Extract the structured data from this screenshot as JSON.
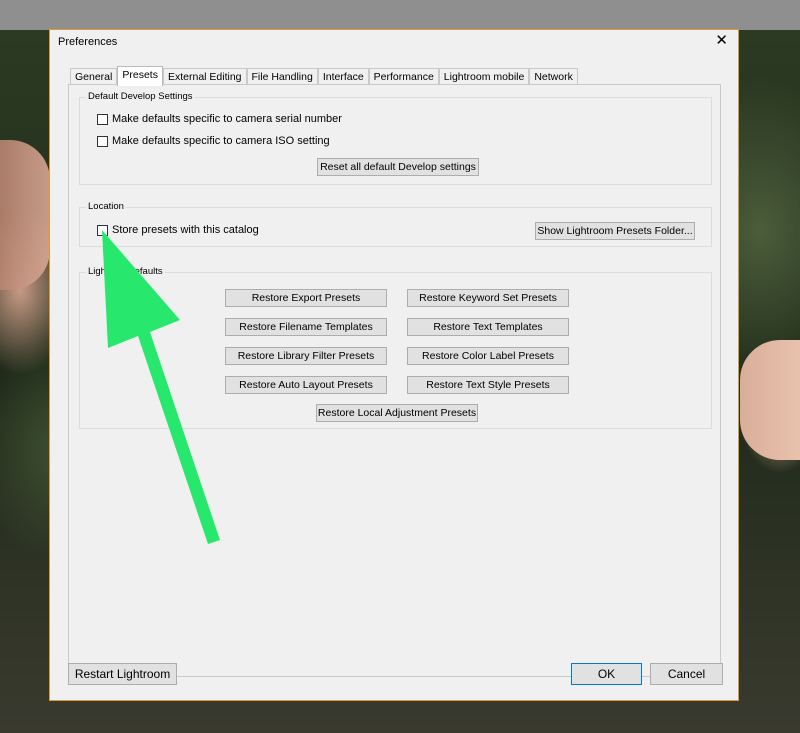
{
  "dialog": {
    "title": "Preferences",
    "close_glyph": "✕",
    "tabs": [
      "General",
      "Presets",
      "External Editing",
      "File Handling",
      "Interface",
      "Performance",
      "Lightroom mobile",
      "Network"
    ],
    "active_tab": "Presets"
  },
  "default_develop": {
    "title": "Default Develop Settings",
    "serial_label": "Make defaults specific to camera serial number",
    "iso_label": "Make defaults specific to camera ISO setting",
    "reset_button": "Reset all default Develop settings"
  },
  "location": {
    "title": "Location",
    "store_label": "Store presets with this catalog",
    "show_folder_button": "Show Lightroom Presets Folder..."
  },
  "defaults": {
    "title_visible": "Lightr",
    "title_suffix": "Defaults",
    "buttons": [
      "Restore Export Presets",
      "Restore Keyword Set Presets",
      "Restore Filename Templates",
      "Restore Text Templates",
      "Restore Library Filter Presets",
      "Restore Color Label Presets",
      "Restore Auto Layout Presets",
      "Restore Text Style Presets",
      "Restore Local Adjustment Presets"
    ]
  },
  "footer": {
    "restart_button": "Restart Lightroom",
    "ok_button": "OK",
    "cancel_button": "Cancel"
  },
  "annotation": {
    "arrow_color": "#27e86d",
    "arrow_icon": "arrow-up-left-icon"
  }
}
